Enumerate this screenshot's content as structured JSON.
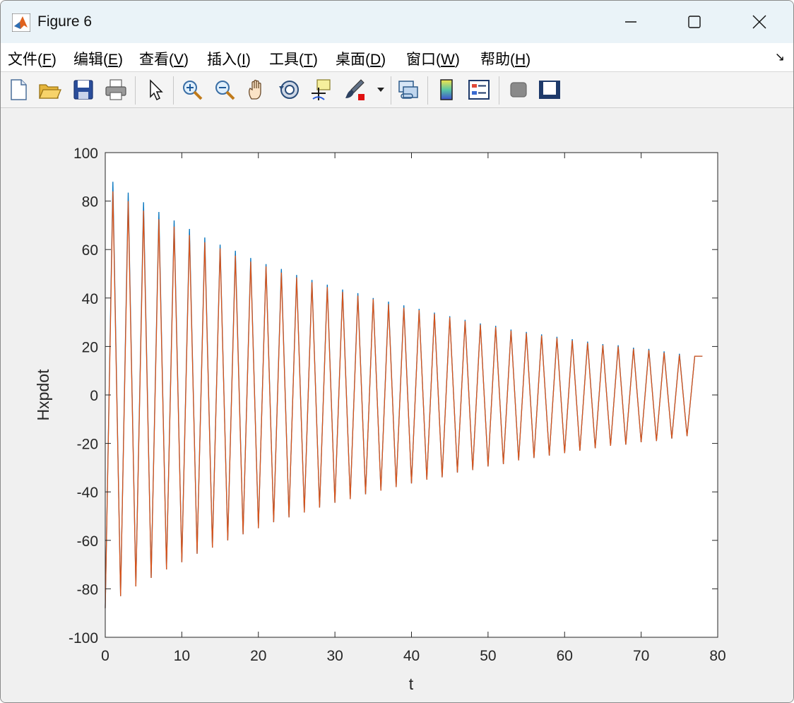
{
  "window": {
    "title": "Figure 6",
    "icon": "matlab-icon"
  },
  "menu": {
    "items": [
      {
        "text": "文件(",
        "key": "F",
        "tail": ")"
      },
      {
        "text": "编辑(",
        "key": "E",
        "tail": ")"
      },
      {
        "text": "查看(",
        "key": "V",
        "tail": ")"
      },
      {
        "text": "插入(",
        "key": "I",
        "tail": ")"
      },
      {
        "text": "工具(",
        "key": "T",
        "tail": ")"
      },
      {
        "text": "桌面(",
        "key": "D",
        "tail": ")"
      },
      {
        "text": "窗口(",
        "key": "W",
        "tail": ")"
      },
      {
        "text": "帮助(",
        "key": "H",
        "tail": ")"
      }
    ],
    "dock_glyph": "↘"
  },
  "toolbar": {
    "icons": [
      "new-figure-icon",
      "open-icon",
      "save-icon",
      "print-icon",
      "pointer-icon",
      "zoom-in-icon",
      "zoom-out-icon",
      "pan-icon",
      "rotate-3d-icon",
      "data-cursor-icon",
      "brush-icon",
      "link-icon",
      "colorbar-icon",
      "legend-icon",
      "hide-plot-tools-icon",
      "show-plot-tools-icon"
    ]
  },
  "colors": {
    "series1": "#0072bd",
    "series2": "#d95319"
  },
  "chart_data": {
    "type": "line",
    "title": "",
    "xlabel": "t",
    "ylabel": "Hxpdot",
    "xlim": [
      0,
      80
    ],
    "ylim": [
      -100,
      100
    ],
    "xticks": [
      0,
      10,
      20,
      30,
      40,
      50,
      60,
      70,
      80
    ],
    "yticks": [
      -100,
      -80,
      -60,
      -40,
      -20,
      0,
      20,
      40,
      60,
      80,
      100
    ],
    "grid": false,
    "legend": "none",
    "series": [
      {
        "x": [
          0,
          1,
          2,
          3,
          4,
          5,
          6,
          7,
          8,
          9,
          10,
          11,
          12,
          13,
          14,
          15,
          16,
          17,
          18,
          19,
          20,
          21,
          22,
          23,
          24,
          25,
          26,
          27,
          28,
          29,
          30,
          31,
          32,
          33,
          34,
          35,
          36,
          37,
          38,
          39,
          40,
          41,
          42,
          43,
          44,
          45,
          46,
          47,
          48,
          49,
          50,
          51,
          52,
          53,
          54,
          55,
          56,
          57,
          58,
          59,
          60,
          61,
          62,
          63,
          64,
          65,
          66,
          67,
          68,
          69,
          70,
          71,
          72,
          73,
          74,
          75,
          76,
          77,
          78
        ],
        "y": [
          -88,
          88,
          -83,
          83.5,
          -79,
          79.5,
          -75.5,
          75.5,
          -72,
          72,
          -69,
          68.5,
          -65.5,
          65,
          -63,
          62,
          -60,
          59.5,
          -57.5,
          56.5,
          -55,
          54,
          -52.5,
          52,
          -50.5,
          49.5,
          -48.5,
          47.5,
          -46.5,
          45.5,
          -44.5,
          43.5,
          -43,
          42,
          -41,
          40,
          -39.5,
          38.5,
          -38,
          37,
          -36.5,
          35.5,
          -35,
          34,
          -34,
          32.5,
          -32,
          31,
          -31,
          29.5,
          -29.5,
          28.5,
          -28.5,
          27,
          -27,
          26,
          -26,
          25,
          -25,
          24,
          -24,
          23,
          -23,
          22,
          -22,
          21,
          -21,
          20.5,
          -20.5,
          19.5,
          -19.5,
          19,
          -19,
          18,
          -18,
          17,
          -17,
          16,
          16
        ]
      },
      {
        "x": [
          0,
          1,
          2,
          3,
          4,
          5,
          6,
          7,
          8,
          9,
          10,
          11,
          12,
          13,
          14,
          15,
          16,
          17,
          18,
          19,
          20,
          21,
          22,
          23,
          24,
          25,
          26,
          27,
          28,
          29,
          30,
          31,
          32,
          33,
          34,
          35,
          36,
          37,
          38,
          39,
          40,
          41,
          42,
          43,
          44,
          45,
          46,
          47,
          48,
          49,
          50,
          51,
          52,
          53,
          54,
          55,
          56,
          57,
          58,
          59,
          60,
          61,
          62,
          63,
          64,
          65,
          66,
          67,
          68,
          69,
          70,
          71,
          72,
          73,
          74,
          75,
          76,
          77,
          78
        ],
        "y": [
          -88,
          84,
          -83,
          80,
          -79,
          76,
          -75.5,
          72.5,
          -72,
          69.5,
          -69,
          66,
          -65.5,
          63,
          -63,
          60.5,
          -60,
          57.5,
          -57.5,
          55,
          -55,
          53,
          -52.5,
          50.5,
          -50.5,
          48.5,
          -48.5,
          46.5,
          -46.5,
          44.5,
          -44.5,
          42.5,
          -43,
          41,
          -41,
          39.5,
          -39.5,
          37.5,
          -38,
          36,
          -36.5,
          35,
          -35,
          33.5,
          -34,
          32,
          -32,
          30.5,
          -31,
          29,
          -29.5,
          28,
          -28.5,
          26.5,
          -27,
          25.5,
          -26,
          24.5,
          -25,
          23.5,
          -24,
          22.5,
          -23,
          21.5,
          -22,
          20.5,
          -21,
          20,
          -20.5,
          19,
          -19.5,
          18.5,
          -19,
          17.5,
          -18,
          16.5,
          -17,
          16,
          16
        ]
      }
    ]
  }
}
